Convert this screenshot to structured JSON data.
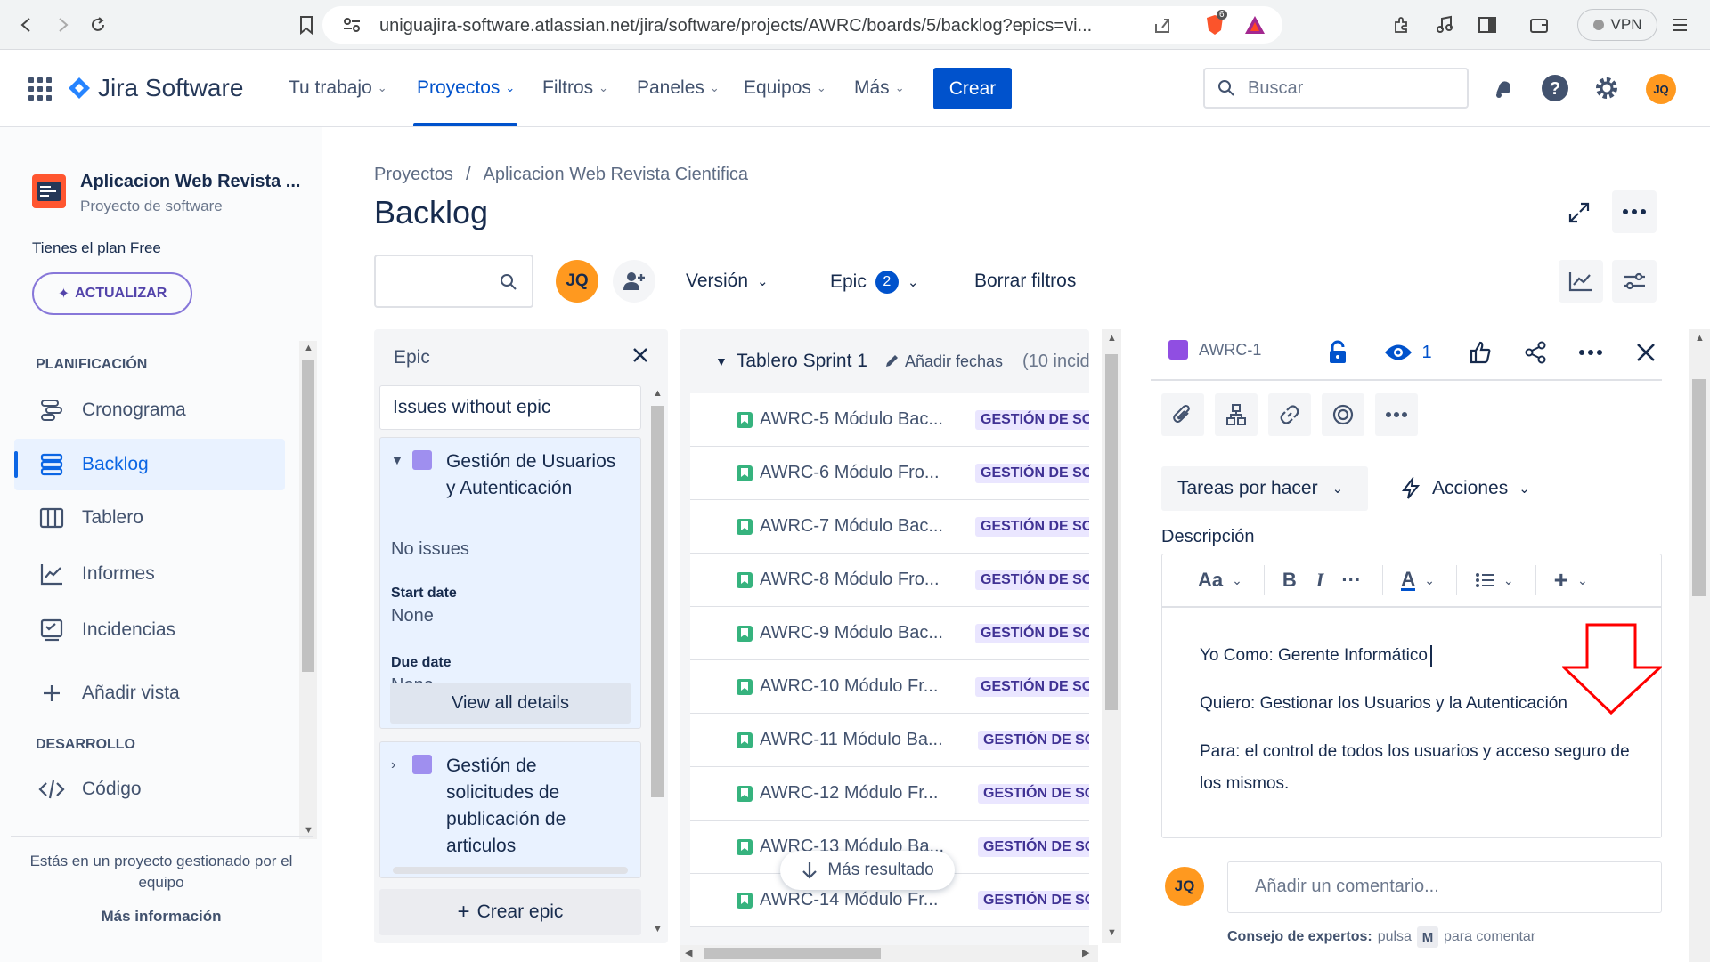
{
  "browser": {
    "url": "uniguajira-software.atlassian.net/jira/software/projects/AWRC/boards/5/backlog?epics=vi...",
    "brave_badge": "6",
    "vpn_label": "VPN"
  },
  "topnav": {
    "product": "Jira Software",
    "items": [
      "Tu trabajo",
      "Proyectos",
      "Filtros",
      "Paneles",
      "Equipos",
      "Más"
    ],
    "active_item": "Proyectos",
    "create_label": "Crear",
    "search_placeholder": "Buscar",
    "user_initials": "JQ"
  },
  "sidebar": {
    "project_name": "Aplicacion Web Revista ...",
    "project_type": "Proyecto de software",
    "plan_text": "Tienes el plan Free",
    "upgrade_label": "ACTUALIZAR",
    "planning_header": "PLANIFICACIÓN",
    "planning_items": [
      {
        "label": "Cronograma",
        "icon": "timeline-icon"
      },
      {
        "label": "Backlog",
        "icon": "backlog-icon",
        "active": true
      },
      {
        "label": "Tablero",
        "icon": "board-icon"
      },
      {
        "label": "Informes",
        "icon": "reports-icon"
      },
      {
        "label": "Incidencias",
        "icon": "issues-icon"
      }
    ],
    "add_view_label": "Añadir vista",
    "dev_header": "DESARROLLO",
    "dev_items": [
      {
        "label": "Código",
        "icon": "code-icon"
      }
    ],
    "footer_text": "Estás en un proyecto gestionado por el equipo",
    "footer_link": "Más información"
  },
  "main": {
    "breadcrumb": [
      "Proyectos",
      "/",
      "Aplicacion Web Revista Cientifica"
    ],
    "title": "Backlog",
    "filter_avatar": "JQ",
    "version_filter": "Versión",
    "epic_filter": "Epic",
    "epic_filter_count": "2",
    "clear_filters": "Borrar filtros"
  },
  "epic_panel": {
    "title": "Epic",
    "no_epic": "Issues without epic",
    "epics": [
      {
        "name": "Gestión de Usuarios y Autenticación",
        "expanded": true,
        "issues_text": "No issues",
        "start_label": "Start date",
        "start_value": "None",
        "due_label": "Due date",
        "due_value": "None",
        "view_all": "View all details"
      },
      {
        "name": "Gestión de solicitudes de publicación de articulos",
        "expanded": false
      }
    ],
    "create_epic": "Crear epic"
  },
  "sprint": {
    "name": "Tablero Sprint 1",
    "add_dates": "Añadir fechas",
    "count_text": "(10 incide",
    "issues": [
      {
        "key": "AWRC-5 Módulo Bac...",
        "epic": "GESTIÓN DE SOLI"
      },
      {
        "key": "AWRC-6 Módulo Fro...",
        "epic": "GESTIÓN DE SOLI"
      },
      {
        "key": "AWRC-7 Módulo Bac...",
        "epic": "GESTIÓN DE SOLI"
      },
      {
        "key": "AWRC-8 Módulo Fro...",
        "epic": "GESTIÓN DE SOLI"
      },
      {
        "key": "AWRC-9 Módulo Bac...",
        "epic": "GESTIÓN DE SOLI"
      },
      {
        "key": "AWRC-10 Módulo Fr...",
        "epic": "GESTIÓN DE SOLI"
      },
      {
        "key": "AWRC-11 Módulo Ba...",
        "epic": "GESTIÓN DE SOLI"
      },
      {
        "key": "AWRC-12 Módulo Fr...",
        "epic": "GESTIÓN DE SOLI"
      },
      {
        "key": "AWRC-13 Módulo Ba...",
        "epic": "GESTIÓN DE SOLI"
      },
      {
        "key": "AWRC-14 Módulo Fr...",
        "epic": "GESTIÓN DE SOLI"
      }
    ],
    "more_results": "Más resultado"
  },
  "detail": {
    "key": "AWRC-1",
    "watchers": "1",
    "status": "Tareas por hacer",
    "actions": "Acciones",
    "description_label": "Descripción",
    "format_label": "Aa",
    "description": [
      "Yo Como: Gerente Informático",
      "Quiero: Gestionar los Usuarios y la Autenticación",
      "Para: el control de todos los usuarios y acceso seguro de los mismos."
    ],
    "comment_initials": "JQ",
    "comment_placeholder": "Añadir un comentario...",
    "protip_bold": "Consejo de expertos:",
    "protip_text1": "pulsa",
    "protip_key": "M",
    "protip_text2": "para comentar"
  },
  "colors": {
    "brand": "#0052cc",
    "epic_purple": "#9f8fef",
    "story_green": "#36b37e",
    "annotation_red": "#ff0000",
    "avatar_orange": "#ff991f"
  }
}
